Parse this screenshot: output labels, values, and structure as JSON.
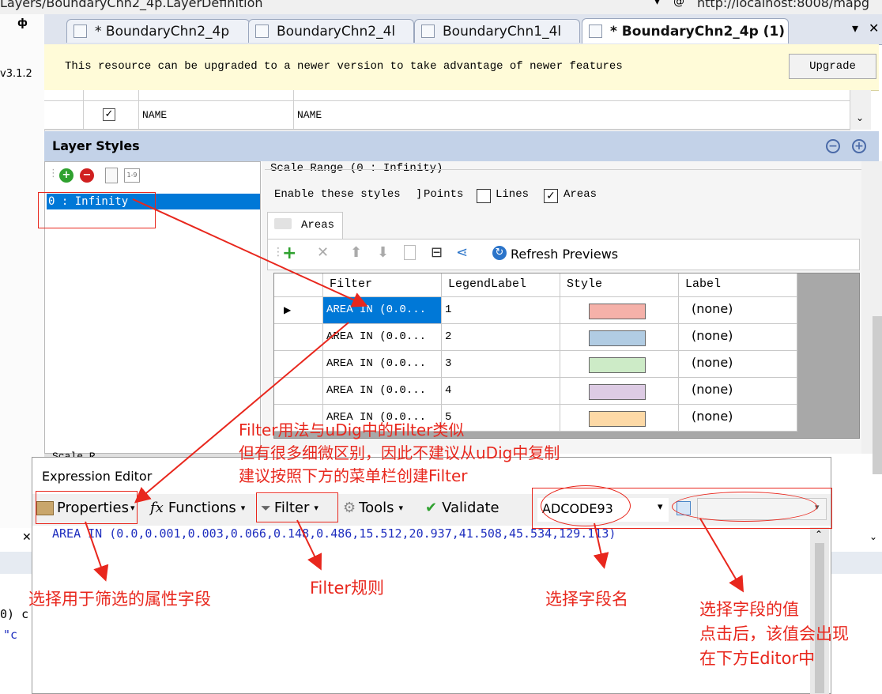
{
  "top": {
    "path_text": "Layers/BoundaryChn2_4p.LayerDefinition",
    "address_text": "http://localhost:8008/mapg",
    "pin_glyph": "ф",
    "version_text": "v3.1.2"
  },
  "tabs": [
    {
      "label": "* BoundaryChn2_4p"
    },
    {
      "label": "BoundaryChn2_4l"
    },
    {
      "label": "BoundaryChn1_4l"
    },
    {
      "label": "* BoundaryChn2_4p (1)"
    }
  ],
  "tabbar_menu_glyph": "▾",
  "tabbar_close_glyph": "✕",
  "notification": {
    "message": "This resource can be upgraded to a newer version to take advantage of newer features",
    "upgrade_button": "Upgrade"
  },
  "property_rows": [
    {
      "checked": true,
      "name": "NAME",
      "value": "NAME"
    }
  ],
  "layer_styles": {
    "title": "Layer Styles",
    "scale_ranges": [
      "0 : Infinity"
    ],
    "scale_range_label": "Scale Range (0 : Infinity)",
    "enable_label": "Enable these styles",
    "points_label": "Points",
    "lines_label": "Lines",
    "areas_label": "Areas",
    "points_checked": false,
    "lines_checked": false,
    "areas_checked": true,
    "active_tab": "Areas",
    "refresh_label": "Refresh Previews",
    "columns": [
      "Filter",
      "LegendLabel",
      "Style",
      "Label"
    ],
    "rules": [
      {
        "filter": "AREA IN (0.0...",
        "legend": "1",
        "color": "#f5b1a9",
        "label": "(none)",
        "selected": true
      },
      {
        "filter": "AREA IN (0.0...",
        "legend": "2",
        "color": "#b1cce3",
        "label": "(none)",
        "selected": false
      },
      {
        "filter": "AREA IN (0.0...",
        "legend": "3",
        "color": "#cdebc7",
        "label": "(none)",
        "selected": false
      },
      {
        "filter": "AREA IN (0.0...",
        "legend": "4",
        "color": "#ddcbe4",
        "label": "(none)",
        "selected": false
      },
      {
        "filter": "AREA IN (0.0...",
        "legend": "5",
        "color": "#fdd9a6",
        "label": "(none)",
        "selected": false
      }
    ],
    "scale_footer": "Scale R"
  },
  "expression_editor": {
    "title": "Expression Editor",
    "menu": {
      "properties": "Properties",
      "functions": "Functions",
      "filter": "Filter",
      "tools": "Tools",
      "validate": "Validate"
    },
    "field_value": "ADCODE93",
    "expression": "AREA IN (0.0,0.001,0.003,0.066,0.148,0.486,15.512,20.937,41.508,45.534,129.113)"
  },
  "background_fragments": {
    "left_code_1": "0) c",
    "left_code_2": "\"c"
  },
  "annotations": {
    "filter_note_lines": [
      "Filter用法与uDig中的Filter类似",
      "但有很多细微区别，因此不建议从uDig中复制",
      "建议按照下方的菜单栏创建Filter"
    ],
    "properties_note": "选择用于筛选的属性字段",
    "filter_rule_note": "Filter规则",
    "field_name_note": "选择字段名",
    "value_note_lines": [
      "选择字段的值",
      "点击后，该值会出现",
      "在下方Editor中"
    ],
    "color": "#e8271d"
  }
}
